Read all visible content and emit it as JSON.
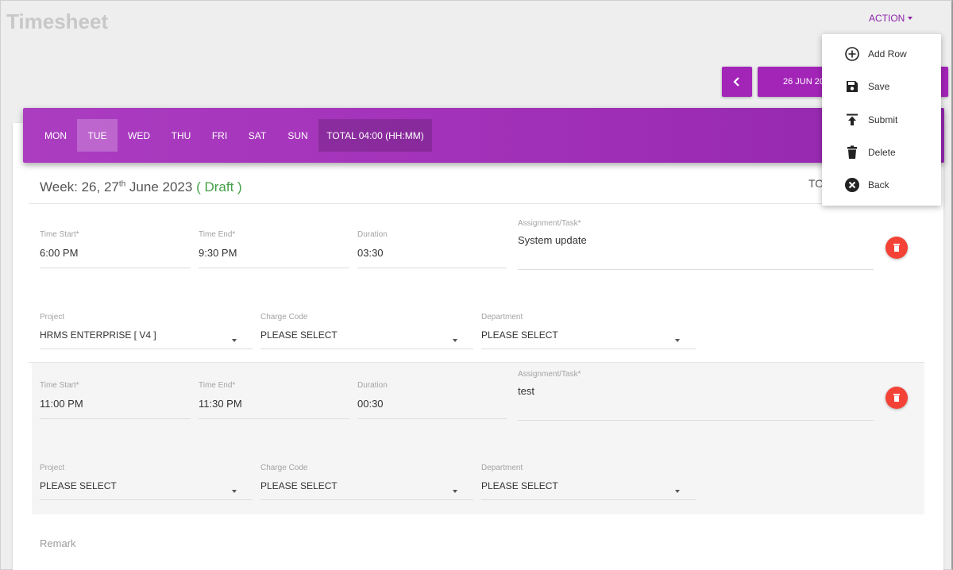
{
  "title": "Timesheet",
  "action": {
    "label": "ACTION"
  },
  "date_range": {
    "label": "26 JUN 2023"
  },
  "days": [
    {
      "label": "MON"
    },
    {
      "label": "TUE"
    },
    {
      "label": "WED"
    },
    {
      "label": "THU"
    },
    {
      "label": "FRI"
    },
    {
      "label": "SAT"
    },
    {
      "label": "SUN"
    }
  ],
  "total": {
    "label": "TOTAL 04:00 (HH:MM)"
  },
  "week": {
    "prefix": "Week: 26, 27",
    "suffix": "th",
    "month": " June 2023 ",
    "status": "( Draft )"
  },
  "tot_truncated": "TO",
  "labels": {
    "time_start": "Time Start*",
    "time_end": "Time End*",
    "duration": "Duration",
    "assignment": "Assignment/Task*",
    "project": "Project",
    "charge_code": "Charge Code",
    "department": "Department",
    "remark": "Remark"
  },
  "entries": [
    {
      "time_start": "6:00 PM",
      "time_end": "9:30 PM",
      "duration": "03:30",
      "assignment": "System update",
      "project": "HRMS ENTERPRISE [ V4 ]",
      "charge_code": "PLEASE SELECT",
      "department": "PLEASE SELECT"
    },
    {
      "time_start": "11:00 PM",
      "time_end": "11:30 PM",
      "duration": "00:30",
      "assignment": "test",
      "project": "PLEASE SELECT",
      "charge_code": "PLEASE SELECT",
      "department": "PLEASE SELECT"
    }
  ],
  "menu": [
    {
      "label": "Add Row",
      "icon": "add-circle-icon"
    },
    {
      "label": "Save",
      "icon": "save-icon"
    },
    {
      "label": "Submit",
      "icon": "upload-icon"
    },
    {
      "label": "Delete",
      "icon": "trash-icon"
    },
    {
      "label": "Back",
      "icon": "close-circle-icon"
    }
  ],
  "colors": {
    "accent": "#a325b8",
    "draft": "#43a047",
    "delete": "#f44336"
  }
}
